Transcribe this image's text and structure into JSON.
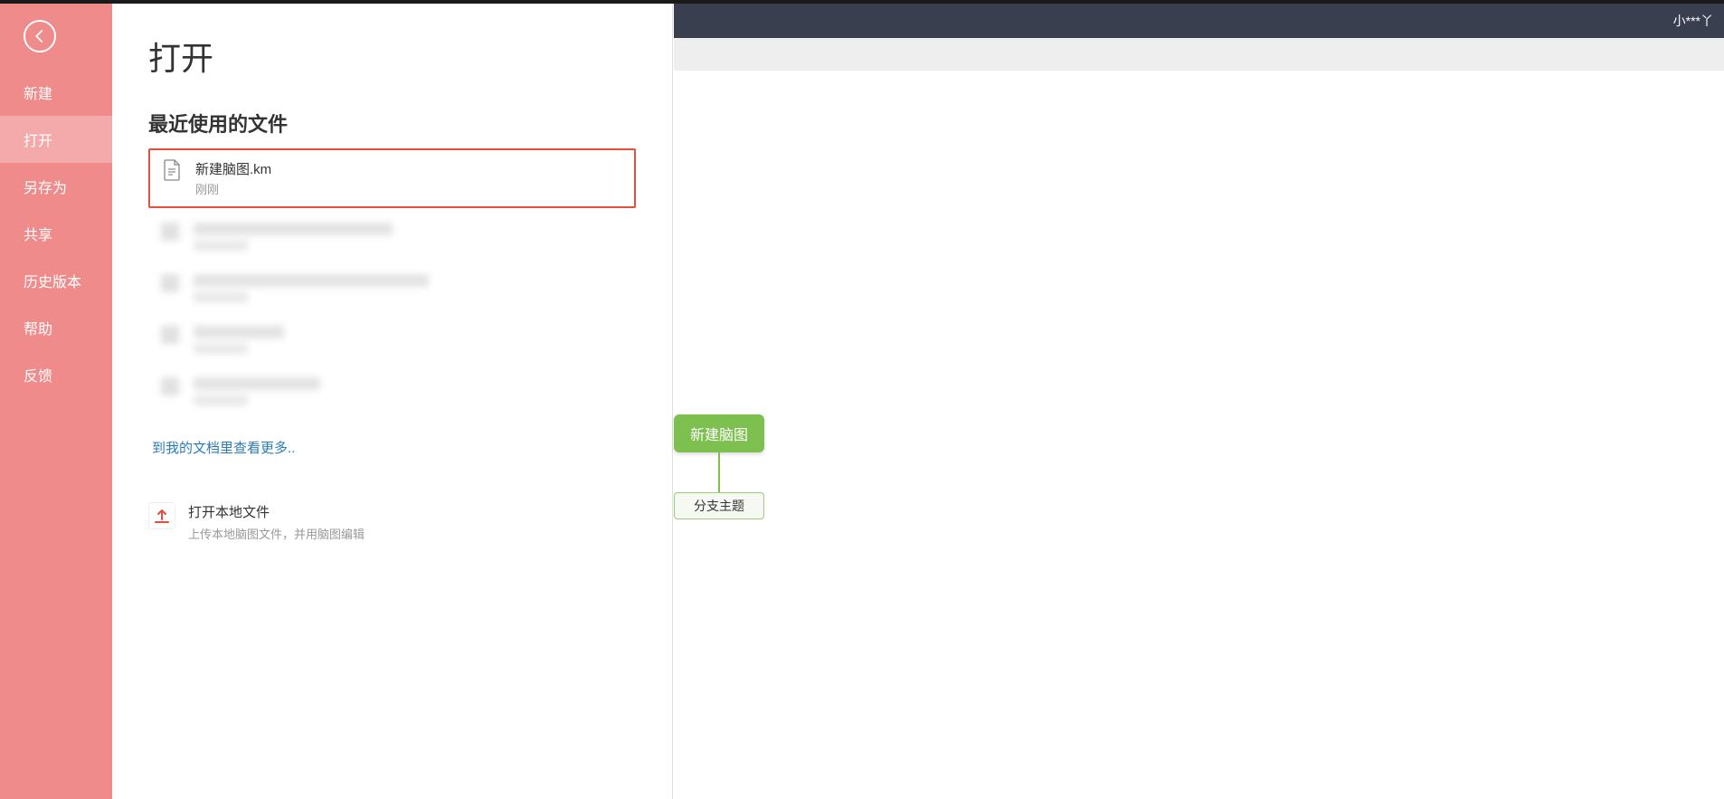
{
  "header": {
    "user_label": "小***丫"
  },
  "sidebar": {
    "items": [
      {
        "label": "新建"
      },
      {
        "label": "打开"
      },
      {
        "label": "另存为"
      },
      {
        "label": "共享"
      },
      {
        "label": "历史版本"
      },
      {
        "label": "帮助"
      },
      {
        "label": "反馈"
      }
    ]
  },
  "panel": {
    "title": "打开",
    "recent_section": "最近使用的文件",
    "first_file": {
      "name": "新建脑图.km",
      "time": "刚刚"
    },
    "more_link": "到我的文档里查看更多..",
    "local_open": {
      "title": "打开本地文件",
      "desc": "上传本地脑图文件，并用脑图编辑"
    }
  },
  "canvas": {
    "root_label": "新建脑图",
    "child_label": "分支主题"
  }
}
